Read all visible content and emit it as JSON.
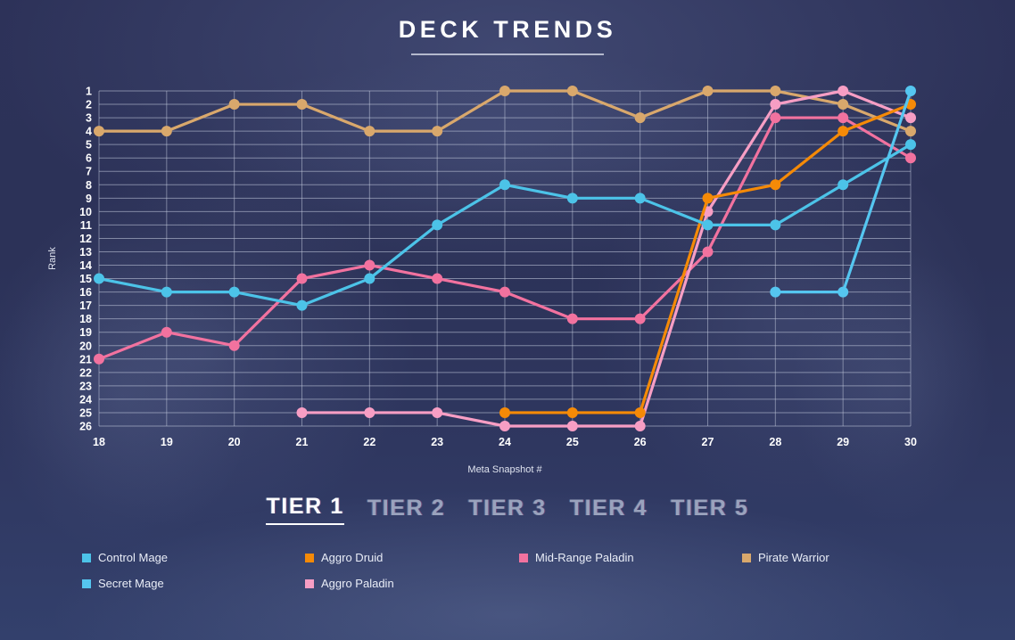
{
  "header": {
    "title": "DECK TRENDS"
  },
  "tiers": [
    {
      "label": "TIER 1",
      "active": true
    },
    {
      "label": "TIER 2",
      "active": false
    },
    {
      "label": "TIER 3",
      "active": false
    },
    {
      "label": "TIER 4",
      "active": false
    },
    {
      "label": "TIER 5",
      "active": false
    }
  ],
  "legend": [
    {
      "label": "Control Mage",
      "color": "#4cc3e8"
    },
    {
      "label": "Aggro Druid",
      "color": "#f58a07"
    },
    {
      "label": "Mid-Range Paladin",
      "color": "#f2729f"
    },
    {
      "label": "Pirate Warrior",
      "color": "#d9a86c"
    },
    {
      "label": "Secret Mage",
      "color": "#55c6f0"
    },
    {
      "label": "Aggro Paladin",
      "color": "#f79ec4"
    }
  ],
  "chart_data": {
    "type": "line",
    "title": "DECK TRENDS",
    "xlabel": "Meta Snapshot #",
    "ylabel": "Rank",
    "x": [
      18,
      19,
      20,
      21,
      22,
      23,
      24,
      25,
      26,
      27,
      28,
      29,
      30
    ],
    "xlim": [
      18,
      30
    ],
    "ylim": [
      1,
      26
    ],
    "y_inverted": true,
    "yticks": [
      1,
      2,
      3,
      4,
      5,
      6,
      7,
      8,
      9,
      10,
      11,
      12,
      13,
      14,
      15,
      16,
      17,
      18,
      19,
      20,
      21,
      22,
      23,
      24,
      25,
      26
    ],
    "grid": true,
    "legend_position": "bottom",
    "series": [
      {
        "name": "Control Mage",
        "color": "#4cc3e8",
        "values": [
          15,
          16,
          16,
          17,
          15,
          11,
          8,
          9,
          9,
          11,
          11,
          8,
          5
        ]
      },
      {
        "name": "Aggro Druid",
        "color": "#f58a07",
        "values": [
          null,
          null,
          null,
          null,
          null,
          null,
          25,
          25,
          25,
          9,
          8,
          4,
          2
        ]
      },
      {
        "name": "Mid-Range Paladin",
        "color": "#f2729f",
        "values": [
          21,
          19,
          20,
          15,
          14,
          15,
          16,
          18,
          18,
          13,
          3,
          3,
          6
        ]
      },
      {
        "name": "Pirate Warrior",
        "color": "#d9a86c",
        "values": [
          4,
          4,
          2,
          2,
          4,
          4,
          1,
          1,
          3,
          1,
          1,
          2,
          4
        ]
      },
      {
        "name": "Secret Mage",
        "color": "#55c6f0",
        "values": [
          null,
          null,
          null,
          null,
          null,
          null,
          null,
          null,
          null,
          null,
          16,
          16,
          1
        ]
      },
      {
        "name": "Aggro Paladin",
        "color": "#f79ec4",
        "values": [
          null,
          null,
          null,
          25,
          25,
          25,
          26,
          26,
          26,
          10,
          2,
          1,
          3
        ]
      }
    ]
  }
}
